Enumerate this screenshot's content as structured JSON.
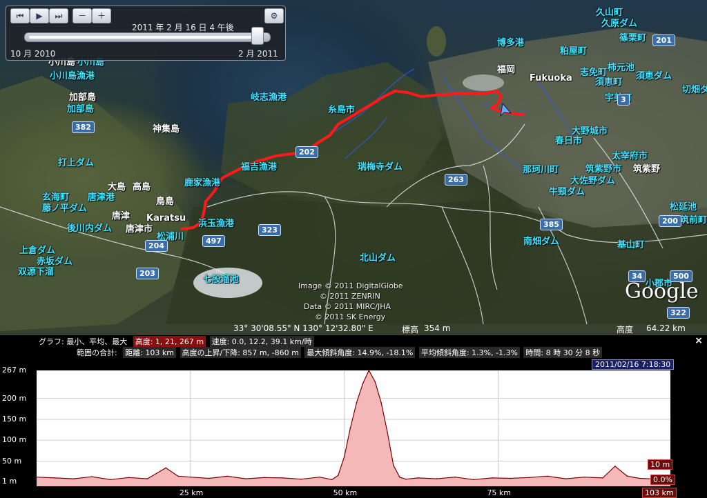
{
  "map": {
    "labels_cyan": [
      {
        "text": "小川島漁港"
      },
      {
        "text": "小川島"
      },
      {
        "text": "加部島"
      },
      {
        "text": "打上ダム"
      },
      {
        "text": "玄海町"
      },
      {
        "text": "藤ノ平ダム"
      },
      {
        "text": "後川内ダム"
      },
      {
        "text": "上倉ダム"
      },
      {
        "text": "赤坂ダム"
      },
      {
        "text": "双源下溜"
      },
      {
        "text": "唐津港"
      },
      {
        "text": "岐志漁港"
      },
      {
        "text": "福吉漁港"
      },
      {
        "text": "鹿家漁港"
      },
      {
        "text": "浜玉漁港"
      },
      {
        "text": "松浦川"
      },
      {
        "text": "瑞梅寺ダム"
      },
      {
        "text": "北山ダム"
      },
      {
        "text": "七股溜池"
      },
      {
        "text": "博多港"
      },
      {
        "text": "久原ダム"
      },
      {
        "text": "篠栗町"
      },
      {
        "text": "粕屋町"
      },
      {
        "text": "志免町"
      },
      {
        "text": "柿元池"
      },
      {
        "text": "須恵町"
      },
      {
        "text": "須恵ダム"
      },
      {
        "text": "宇美町"
      },
      {
        "text": "切畑ダ"
      },
      {
        "text": "大野城市"
      },
      {
        "text": "春日市"
      },
      {
        "text": "那珂川町"
      },
      {
        "text": "太宰府市"
      },
      {
        "text": "筑紫野市"
      },
      {
        "text": "大佐野ダム"
      },
      {
        "text": "牛頸ダム"
      },
      {
        "text": "南畑ダム"
      },
      {
        "text": "松延池"
      },
      {
        "text": "筑前町"
      },
      {
        "text": "基山町"
      },
      {
        "text": "小郡市"
      },
      {
        "text": "糸島市"
      },
      {
        "text": "久山町"
      }
    ],
    "labels_white": [
      {
        "text": "小川島"
      },
      {
        "text": "加部島"
      },
      {
        "text": "神集島"
      },
      {
        "text": "大島"
      },
      {
        "text": "高島"
      },
      {
        "text": "鳥島"
      },
      {
        "text": "唐津"
      },
      {
        "text": "Karatsu"
      },
      {
        "text": "唐津市"
      },
      {
        "text": "福岡"
      },
      {
        "text": "Fukuoka"
      },
      {
        "text": "筑紫野"
      }
    ],
    "shields": [
      {
        "num": "382"
      },
      {
        "num": "202"
      },
      {
        "num": "263"
      },
      {
        "num": "323"
      },
      {
        "num": "497"
      },
      {
        "num": "204"
      },
      {
        "num": "203"
      },
      {
        "num": "385"
      },
      {
        "num": "200"
      },
      {
        "num": "201"
      },
      {
        "num": "3"
      },
      {
        "num": "34"
      },
      {
        "num": "500"
      },
      {
        "num": "322"
      }
    ],
    "credits": [
      "Image © 2011 DigitalGlobe",
      "© 2011 ZENRIN",
      "Data © 2011 MIRC/JHA",
      "© 2011 SK Energy"
    ],
    "logo": "Google",
    "status": {
      "coords": "33° 30'08.55\" N   130° 12'32.80\" E",
      "elev_label": "標高",
      "elev_value": "354 m",
      "alt_label": "高度",
      "alt_value": "64.22 km"
    }
  },
  "time_slider": {
    "current": "2011 年 2 月 16 日  4 午後",
    "start": "10 月 2010",
    "end": "2 月 2011",
    "progress": 0.97,
    "buttons": [
      "前へ",
      "再生",
      "次へ",
      "ズームアウト",
      "ズームイン",
      "設定"
    ]
  },
  "profile": {
    "graph_label": "グラフ: 最小、平均、最大",
    "altitude_cell": "高度: 1, 21, 267 m",
    "speed_cell": "速度: 0.0, 12.2, 39.1 km/時",
    "range_label": "範囲の合計:",
    "distance_cell": "距離: 103 km",
    "gain_cell": "高度の上昇/下降: 857 m, -860 m",
    "max_slope_cell": "最大傾斜角度: 14.9%, -18.1%",
    "avg_slope_cell": "平均傾斜角度: 1.3%, -1.3%",
    "time_cell": "時間: 8 時 30 分 8 秒",
    "close": "×",
    "date_marker": "2011/02/16 7:18:30",
    "badge_elev": "10 m",
    "badge_slope": "0.0%",
    "badge_dist": "103 km",
    "accent": "#d81b1b"
  },
  "chart_data": {
    "type": "area",
    "x": [
      0,
      3,
      6,
      9,
      12,
      15,
      18,
      21,
      23,
      25,
      28,
      31,
      34,
      37,
      40,
      43,
      46,
      48,
      49,
      50,
      51,
      52,
      53,
      54,
      55,
      56,
      57,
      58,
      59,
      60,
      62,
      65,
      68,
      71,
      74,
      77,
      80,
      83,
      86,
      89,
      92,
      94,
      96,
      98,
      101,
      103
    ],
    "values": [
      12,
      10,
      8,
      13,
      6,
      11,
      8,
      34,
      14,
      12,
      9,
      14,
      8,
      11,
      10,
      7,
      12,
      6,
      16,
      60,
      130,
      190,
      235,
      267,
      240,
      190,
      120,
      40,
      12,
      7,
      10,
      8,
      12,
      6,
      10,
      9,
      11,
      14,
      8,
      12,
      10,
      38,
      14,
      9,
      7,
      10
    ],
    "xlabel": "",
    "ylabel": "",
    "x_ticks": [
      "25 km",
      "50 km",
      "75 km"
    ],
    "x_tick_values": [
      25,
      50,
      75
    ],
    "y_ticks": [
      "267 m",
      "200 m",
      "150 m",
      "100 m",
      "50 m",
      "1 m"
    ],
    "y_tick_values": [
      267,
      200,
      150,
      100,
      50,
      1
    ],
    "xlim": [
      0,
      103
    ],
    "ylim": [
      -10,
      267
    ],
    "grid": true,
    "fill_color": "#f4b8b8",
    "line_color": "#7a0000"
  }
}
